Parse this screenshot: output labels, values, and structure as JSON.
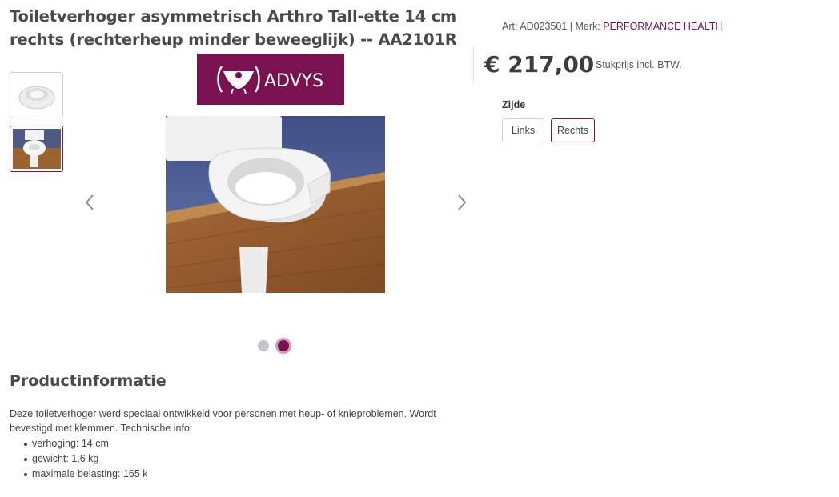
{
  "product": {
    "title": "Toiletverhoger asymmetrisch Arthro Tall-ette 14 cm rechts (rechterheup minder beweeglijk) -- AA2101R",
    "art_label": "Art: AD023501 | Merk: ",
    "brand": "PERFORMANCE HEALTH",
    "price": "€ 217,00",
    "price_note": "Stukprijs incl. BTW."
  },
  "brand_logo": {
    "text": "ADVYS"
  },
  "gallery": {
    "thumbnails": [
      "toilet-seat-raiser-photo",
      "toilet-seat-raiser-in-bathroom-photo"
    ],
    "active_index": 1,
    "dots": 2
  },
  "option": {
    "label": "Zijde",
    "choices": [
      "Links",
      "Rechts"
    ],
    "selected": "Rechts"
  },
  "info": {
    "heading": "Productinformatie",
    "description": "Deze toiletverhoger werd speciaal ontwikkeld voor personen met heup- of knieproblemen. Wordt bevestigd met klemmen. Technische info:",
    "specs": [
      "verhoging: 14 cm",
      "gewicht: 1,6 kg",
      "maximale belasting: 165 k"
    ]
  },
  "colors": {
    "accent": "#7a1252",
    "dot_inactive": "#c2c6cc",
    "text_dark": "#4a4a4a"
  }
}
